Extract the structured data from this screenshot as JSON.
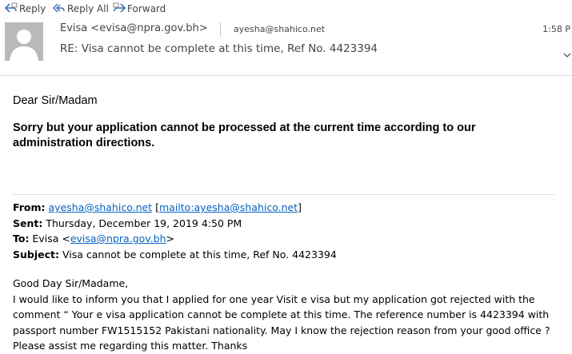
{
  "toolbar": {
    "reply_label": "Reply",
    "reply_all_label": "Reply All",
    "forward_label": "Forward"
  },
  "header": {
    "sender": "Evisa <evisa@npra.gov.bh>",
    "recipient": "ayesha@shahico.net",
    "time": "1:58 P",
    "subject": "RE: Visa cannot be complete at this time, Ref No. 4423394"
  },
  "body": {
    "greeting": "Dear Sir/Madam",
    "notice": "Sorry but your application cannot be processed at the current time according to our administration directions."
  },
  "quoted": {
    "from_label": "From:",
    "from_email": "ayesha@shahico.net",
    "from_open": " [",
    "from_mailto": "mailto:ayesha@shahico.net",
    "from_close": "]",
    "sent_label": "Sent:",
    "sent_value": " Thursday, December 19, 2019 4:50 PM",
    "to_label": "To:",
    "to_name": " Evisa <",
    "to_email": "evisa@npra.gov.bh",
    "to_close": ">",
    "subject_label": "Subject:",
    "subject_value": " Visa cannot be complete at this time, Ref No. 4423394",
    "lines": [
      "Good Day Sir/Madame,",
      "I would like to inform you that I applied for one year Visit e visa but my application got rejected with the",
      "comment “ Your e visa application cannot be complete at this time. The reference number is 4423394 with",
      "passport number FW1515152 Pakistani nationality. May I know the rejection reason from your good office ?",
      "Please assist me regarding this matter. Thanks"
    ]
  },
  "colors": {
    "link": "#0563c1",
    "avatar": "#b9b9b9",
    "header_text": "#444444"
  },
  "icons": [
    "reply-icon",
    "reply-all-icon",
    "forward-icon",
    "person-icon",
    "chevron-down-icon"
  ]
}
